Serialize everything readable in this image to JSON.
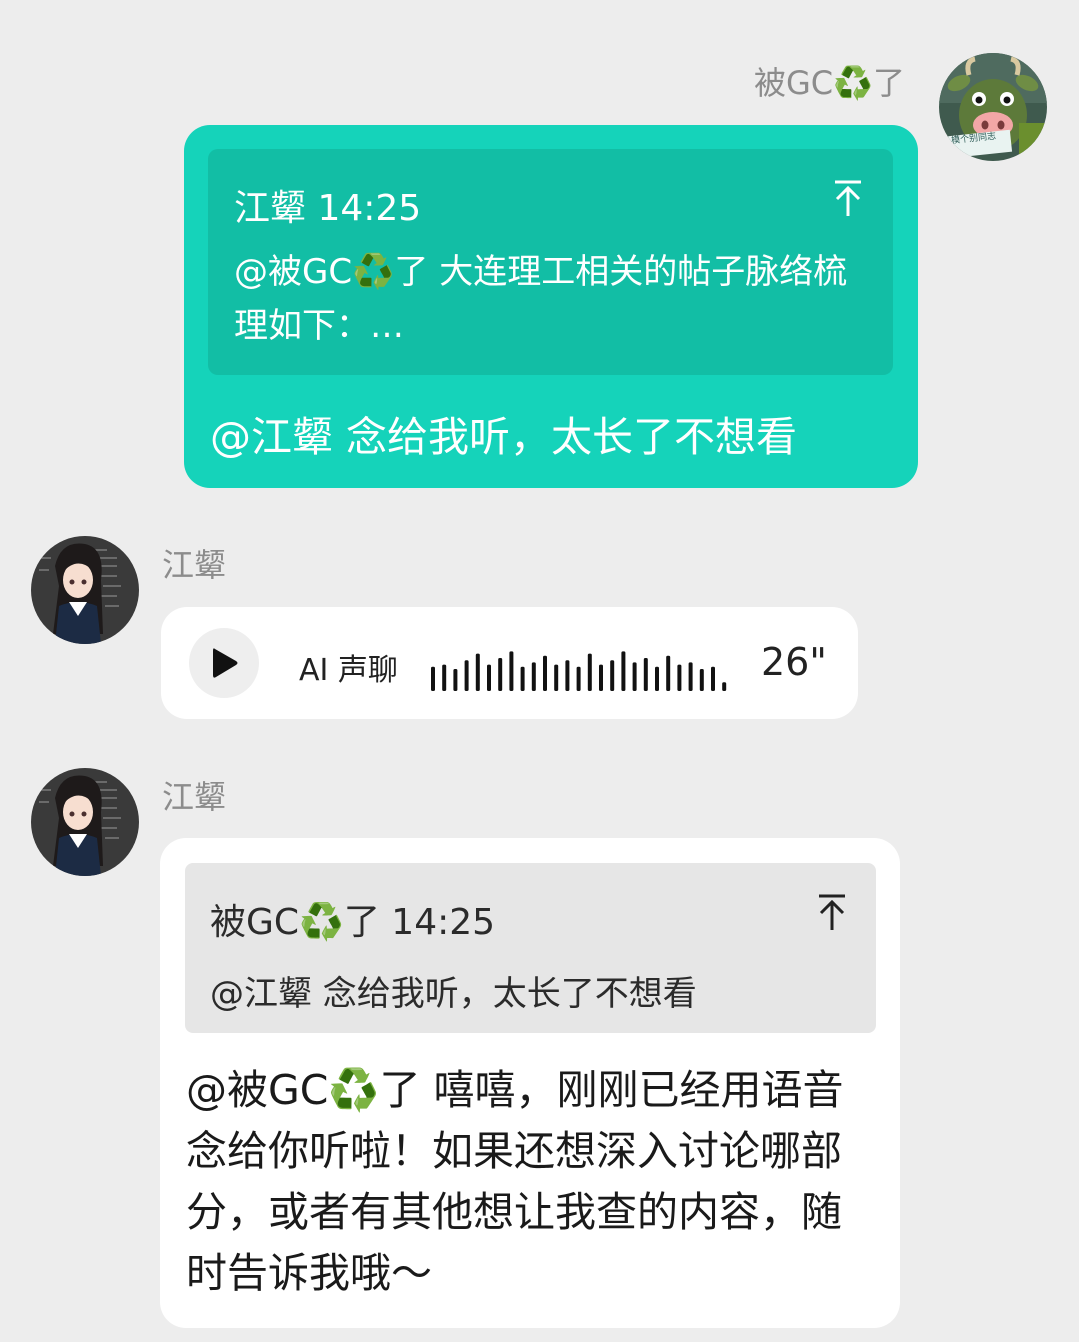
{
  "messages": [
    {
      "sender": "被GC♻️了",
      "quote": {
        "header": "江颦 14:25",
        "text": "@被GC♻️了 大连理工相关的帖子脉络梳理如下：…"
      },
      "text": "@江颦 念给我听，太长了不想看"
    },
    {
      "sender": "江颦",
      "voice": {
        "label": "AI 声聊",
        "duration": "26\""
      }
    },
    {
      "sender": "江颦",
      "quote": {
        "header": "被GC♻️了 14:25",
        "text": "@江颦 念给我听，太长了不想看"
      },
      "text": "@被GC♻️了 嘻嘻，刚刚已经用语音念给你听啦！如果还想深入讨论哪部分，或者有其他想让我查的内容，随时告诉我哦～"
    }
  ],
  "avatars": {
    "self_badge_text": "模个别同志"
  },
  "colors": {
    "background": "#EDEDED",
    "outgoing_bubble": "#15D3BA",
    "outgoing_quote": "#12BEA5",
    "incoming_bubble": "#FFFFFF",
    "incoming_quote": "#E6E6E6",
    "name_text": "#8C8C8C"
  },
  "icons": [
    "play-icon",
    "jump-to-quote-icon",
    "recycle-emoji"
  ],
  "waveform_levels": [
    0.55,
    0.6,
    0.5,
    0.7,
    0.85,
    0.6,
    0.75,
    0.9,
    0.55,
    0.65,
    0.8,
    0.6,
    0.7,
    0.55,
    0.85,
    0.6,
    0.7,
    0.9,
    0.65,
    0.75,
    0.55,
    0.8,
    0.6,
    0.65,
    0.5,
    0.55,
    0.2
  ]
}
